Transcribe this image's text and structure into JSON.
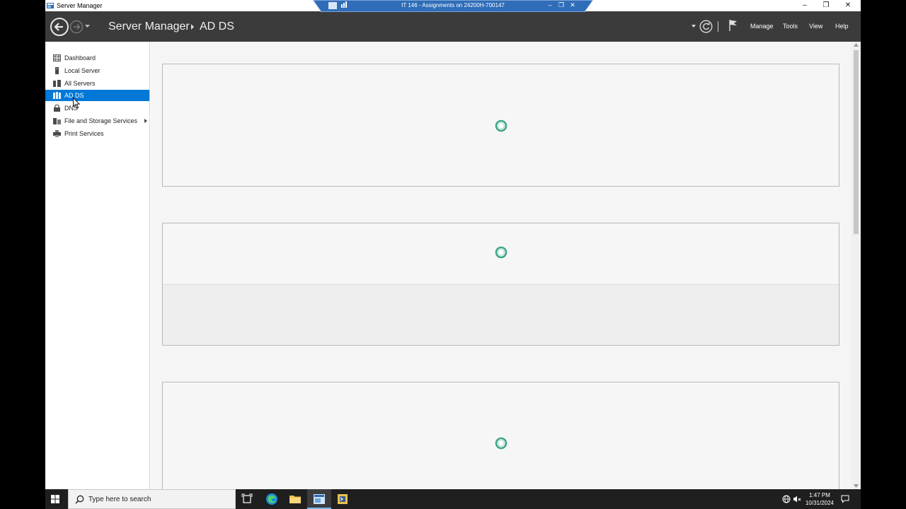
{
  "window": {
    "title": "Server Manager",
    "controls": {
      "minimize": "–",
      "restore": "❐",
      "close": "✕"
    }
  },
  "remote_bar": {
    "title": "IT 146 - Assignments on 24200H-700147",
    "minimize": "–",
    "restore": "❐",
    "close": "✕"
  },
  "header": {
    "breadcrumb_root": "Server Manager",
    "breadcrumb_leaf": "AD DS",
    "menus": [
      "Manage",
      "Tools",
      "View",
      "Help"
    ]
  },
  "sidebar": {
    "items": [
      {
        "label": "Dashboard",
        "icon": "dashboard-icon",
        "selected": false
      },
      {
        "label": "Local Server",
        "icon": "local-server-icon",
        "selected": false
      },
      {
        "label": "All Servers",
        "icon": "all-servers-icon",
        "selected": false
      },
      {
        "label": "AD DS",
        "icon": "ad-ds-icon",
        "selected": true
      },
      {
        "label": "DNS",
        "icon": "dns-icon",
        "selected": false
      },
      {
        "label": "File and Storage Services",
        "icon": "file-storage-icon",
        "selected": false,
        "has_submenu": true
      },
      {
        "label": "Print Services",
        "icon": "printer-icon",
        "selected": false
      }
    ]
  },
  "main": {
    "tiles": [
      {
        "name": "servers-tile",
        "state": "loading"
      },
      {
        "name": "events-tile",
        "state": "loading"
      },
      {
        "name": "services-tile",
        "state": "loading"
      }
    ]
  },
  "taskbar": {
    "search_placeholder": "Type here to search",
    "clock_time": "1:47 PM",
    "clock_date": "10/31/2024"
  },
  "colors": {
    "header_bg": "#3b3b3b",
    "selection": "#0078d7",
    "spinner": "#3fa58a",
    "taskbar_bg": "#1f1f1f"
  }
}
